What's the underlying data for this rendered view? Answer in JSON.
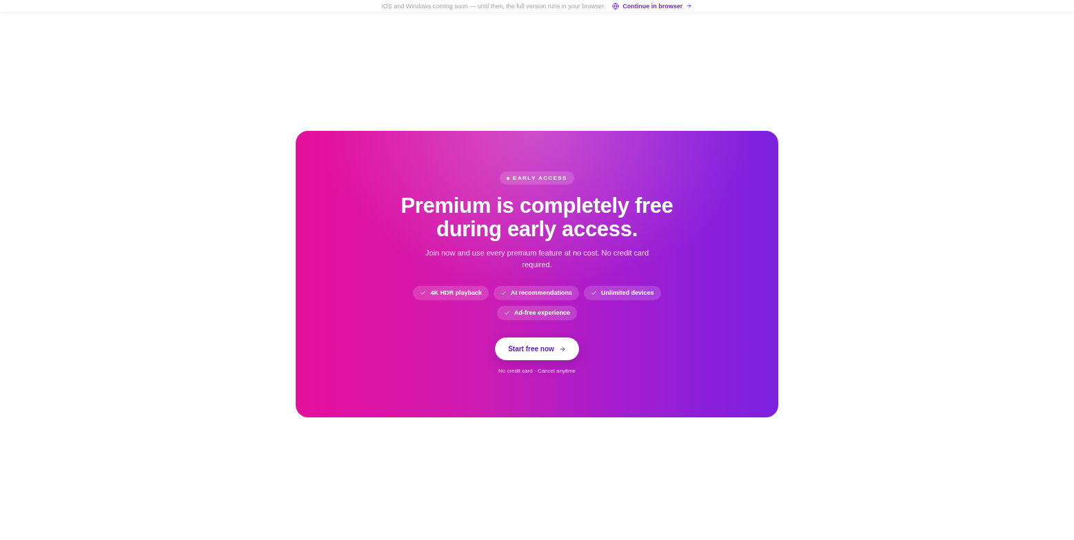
{
  "top_bar": {
    "notice": "iOS and Windows coming soon — until then, the full version runs in your browser.",
    "link": "Continue in browser"
  },
  "promo": {
    "badge": "EARLY ACCESS",
    "title": "Premium is completely free during early access.",
    "subtitle": "Join now and use every premium feature at no cost. No credit card required.",
    "features": [
      "4K HDR playback",
      "AI recommendations",
      "Unlimited devices",
      "Ad-free experience"
    ],
    "cta": "Start free now",
    "footnote": "No credit card · Cancel anytime"
  }
}
